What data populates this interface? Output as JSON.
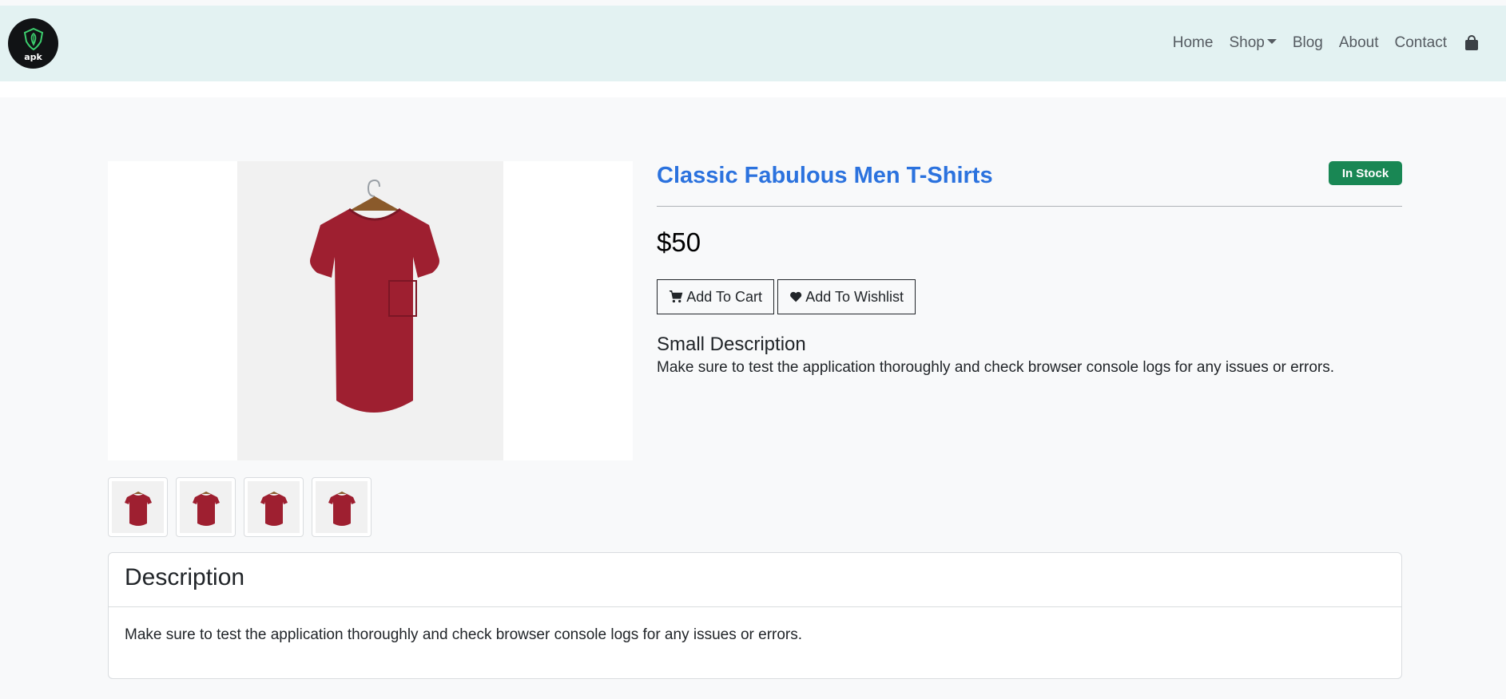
{
  "brand": {
    "logo_text": "apk"
  },
  "nav": {
    "items": [
      {
        "label": "Home"
      },
      {
        "label": "Shop"
      },
      {
        "label": "Blog"
      },
      {
        "label": "About"
      },
      {
        "label": "Contact"
      }
    ],
    "cart_icon": "shopping-bag-icon"
  },
  "product": {
    "title": "Classic Fabulous Men T-Shirts",
    "stock_badge": "In Stock",
    "price": "$50",
    "add_to_cart_label": "Add To Cart",
    "add_to_wishlist_label": "Add To Wishlist",
    "small_description_title": "Small Description",
    "small_description": "Make sure to test the application thoroughly and check browser console logs for any issues or errors.",
    "image_alt_icon": "tshirt-image",
    "thumbnail_count": 4
  },
  "description": {
    "header": "Description",
    "body": "Make sure to test the application thoroughly and check browser console logs for any issues or errors."
  },
  "colors": {
    "navbar_bg": "#e3f2f2",
    "title": "#2b72de",
    "badge_bg": "#198754",
    "shirt": "#9e1f30"
  }
}
